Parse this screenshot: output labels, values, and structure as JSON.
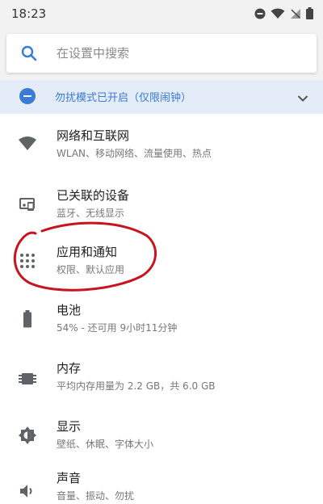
{
  "status_bar": {
    "time": "18:23",
    "icons": [
      "dnd-icon",
      "wifi-icon",
      "signal-off-icon",
      "battery-icon"
    ]
  },
  "search": {
    "placeholder": "在设置中搜索",
    "value": ""
  },
  "dnd_banner": {
    "text": "勿扰模式已开启（仅限闹钟）",
    "icon": "dnd-minus-icon",
    "accent_color": "#3b7ad6"
  },
  "settings": {
    "items": [
      {
        "title": "网络和互联网",
        "subtitle": "WLAN、移动网络、流量使用、热点",
        "icon": "wifi-icon"
      },
      {
        "title": "已关联的设备",
        "subtitle": "蓝牙、无线显示",
        "icon": "devices-icon"
      },
      {
        "title": "应用和通知",
        "subtitle": "权限、默认应用",
        "icon": "apps-icon"
      },
      {
        "title": "电池",
        "subtitle": "54% - 还可用 9小时11分钟",
        "icon": "battery-icon"
      },
      {
        "title": "内存",
        "subtitle": "平均内存用量为 2.2 GB，共 6.0 GB",
        "icon": "memory-icon"
      },
      {
        "title": "显示",
        "subtitle": "壁纸、休眠、字体大小",
        "icon": "brightness-icon"
      },
      {
        "title": "声音",
        "subtitle": "音量、振动、勿扰",
        "icon": "volume-icon"
      }
    ]
  },
  "annotation": {
    "color": "#c8141e",
    "marks": "apps-and-notifications"
  }
}
